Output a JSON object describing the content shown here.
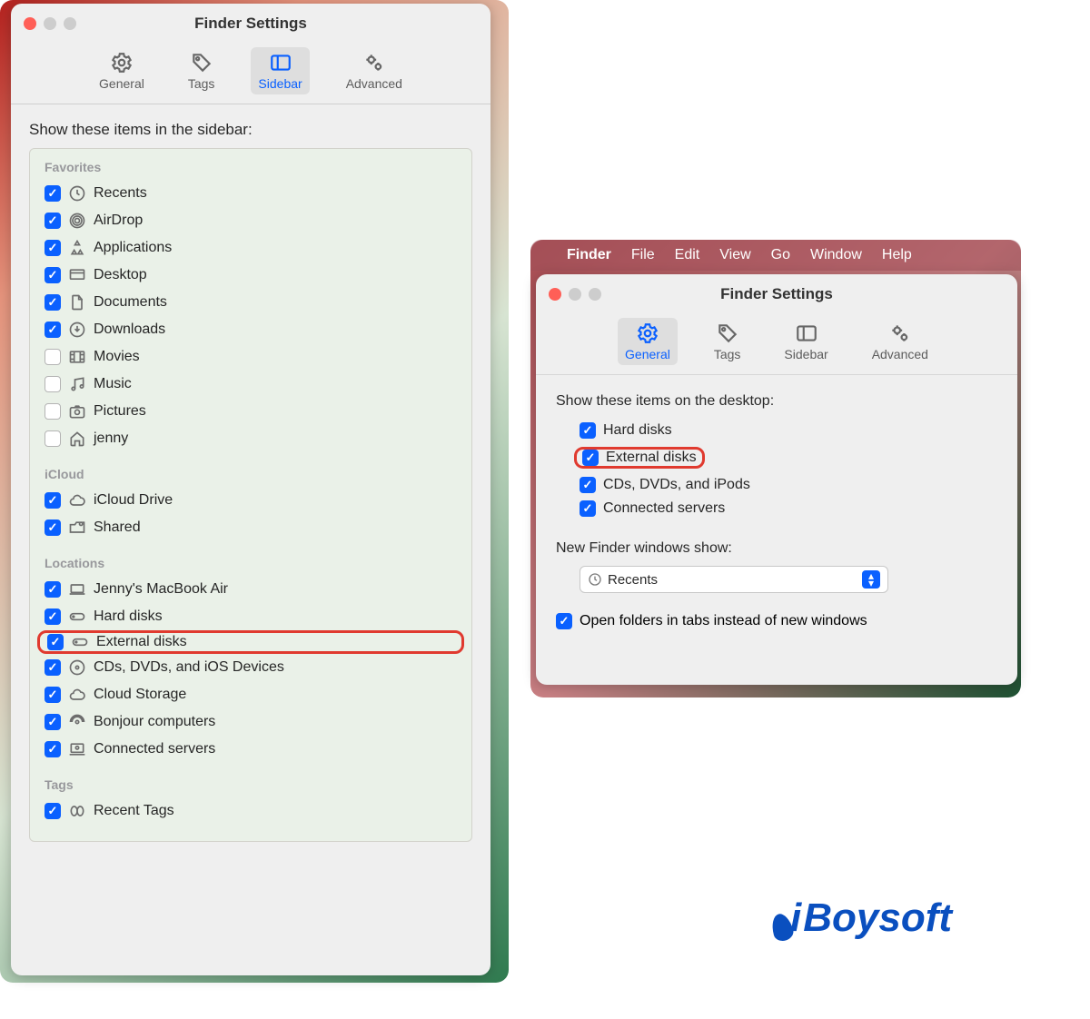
{
  "left": {
    "title": "Finder Settings",
    "tabs": {
      "general": "General",
      "tags": "Tags",
      "sidebar": "Sidebar",
      "advanced": "Advanced"
    },
    "heading": "Show these items in the sidebar:",
    "groups": {
      "favorites": {
        "head": "Favorites",
        "items": [
          {
            "label": "Recents",
            "checked": true,
            "icon": "clock"
          },
          {
            "label": "AirDrop",
            "checked": true,
            "icon": "airdrop"
          },
          {
            "label": "Applications",
            "checked": true,
            "icon": "apps"
          },
          {
            "label": "Desktop",
            "checked": true,
            "icon": "desktop"
          },
          {
            "label": "Documents",
            "checked": true,
            "icon": "doc"
          },
          {
            "label": "Downloads",
            "checked": true,
            "icon": "download"
          },
          {
            "label": "Movies",
            "checked": false,
            "icon": "movie"
          },
          {
            "label": "Music",
            "checked": false,
            "icon": "music"
          },
          {
            "label": "Pictures",
            "checked": false,
            "icon": "camera"
          },
          {
            "label": "jenny",
            "checked": false,
            "icon": "home"
          }
        ]
      },
      "icloud": {
        "head": "iCloud",
        "items": [
          {
            "label": "iCloud Drive",
            "checked": true,
            "icon": "cloud"
          },
          {
            "label": "Shared",
            "checked": true,
            "icon": "shared"
          }
        ]
      },
      "locations": {
        "head": "Locations",
        "items": [
          {
            "label": "Jenny's MacBook Air",
            "checked": true,
            "icon": "laptop"
          },
          {
            "label": "Hard disks",
            "checked": true,
            "icon": "hd"
          },
          {
            "label": "External disks",
            "checked": true,
            "icon": "hd",
            "highlight": true
          },
          {
            "label": "CDs, DVDs, and iOS Devices",
            "checked": true,
            "icon": "disc"
          },
          {
            "label": "Cloud Storage",
            "checked": true,
            "icon": "cloud"
          },
          {
            "label": "Bonjour computers",
            "checked": true,
            "icon": "bonjour"
          },
          {
            "label": "Connected servers",
            "checked": true,
            "icon": "server"
          }
        ]
      },
      "tags": {
        "head": "Tags",
        "items": [
          {
            "label": "Recent Tags",
            "checked": true,
            "icon": "tag"
          }
        ]
      }
    }
  },
  "menubar": {
    "app": "Finder",
    "items": [
      "File",
      "Edit",
      "View",
      "Go",
      "Window",
      "Help"
    ]
  },
  "right": {
    "title": "Finder Settings",
    "tabs": {
      "general": "General",
      "tags": "Tags",
      "sidebar": "Sidebar",
      "advanced": "Advanced"
    },
    "heading": "Show these items on the desktop:",
    "items": [
      {
        "label": "Hard disks",
        "checked": true
      },
      {
        "label": "External disks",
        "checked": true,
        "highlight": true
      },
      {
        "label": "CDs, DVDs, and iPods",
        "checked": true
      },
      {
        "label": "Connected servers",
        "checked": true
      }
    ],
    "newWindowsLabel": "New Finder windows show:",
    "newWindowsValue": "Recents",
    "openInTabs": {
      "label": "Open folders in tabs instead of new windows",
      "checked": true
    }
  },
  "brand": "Boysoft"
}
